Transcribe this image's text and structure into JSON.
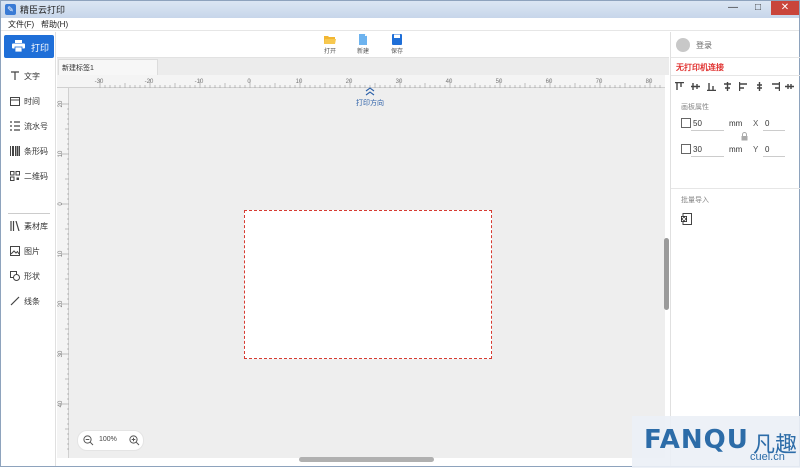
{
  "window": {
    "title": "精臣云打印",
    "controls": {
      "minimize": "—",
      "maximize": "□",
      "close": "✕"
    }
  },
  "menu": {
    "items": [
      "文件(F)",
      "帮助(H)"
    ]
  },
  "left_sidebar": {
    "print_label": "打印",
    "tools": [
      {
        "label": "文字",
        "icon": "text-icon"
      },
      {
        "label": "时间",
        "icon": "calendar-icon"
      },
      {
        "label": "流水号",
        "icon": "serial-number-icon"
      },
      {
        "label": "条形码",
        "icon": "barcode-icon"
      },
      {
        "label": "二维码",
        "icon": "qrcode-icon"
      }
    ],
    "tools2": [
      {
        "label": "素材库",
        "icon": "library-icon"
      },
      {
        "label": "图片",
        "icon": "image-icon"
      },
      {
        "label": "形状",
        "icon": "shape-icon"
      },
      {
        "label": "线条",
        "icon": "line-icon"
      }
    ]
  },
  "toolbar": {
    "open_label": "打开",
    "new_label": "新建",
    "save_label": "保存"
  },
  "tabs": [
    {
      "label": "新建标签1"
    }
  ],
  "rulers": {
    "horizontal_ticks": [
      "-30",
      "-20",
      "-10",
      "0",
      "10",
      "20",
      "30",
      "40",
      "50",
      "60",
      "70",
      "80"
    ],
    "vertical_ticks": [
      "20",
      "10",
      "0",
      "10",
      "20",
      "30",
      "40"
    ]
  },
  "canvas": {
    "print_direction_label": "打印方向"
  },
  "zoom": {
    "value": "100%"
  },
  "right_panel": {
    "login_label": "登录",
    "printer_status": "无打印机连接",
    "canvas_props_title": "画板属性",
    "width": "50",
    "height": "30",
    "unit": "mm",
    "x_label": "X",
    "x_value": "0",
    "y_label": "Y",
    "y_value": "0",
    "batch_import_title": "批量导入"
  },
  "watermark": {
    "brand": "FANQU",
    "brand_cn": "凡趣",
    "url": "cuel.cn"
  },
  "colors": {
    "accent": "#1f6fd8",
    "status_error": "#e0312f",
    "label_border": "#d63b32"
  }
}
